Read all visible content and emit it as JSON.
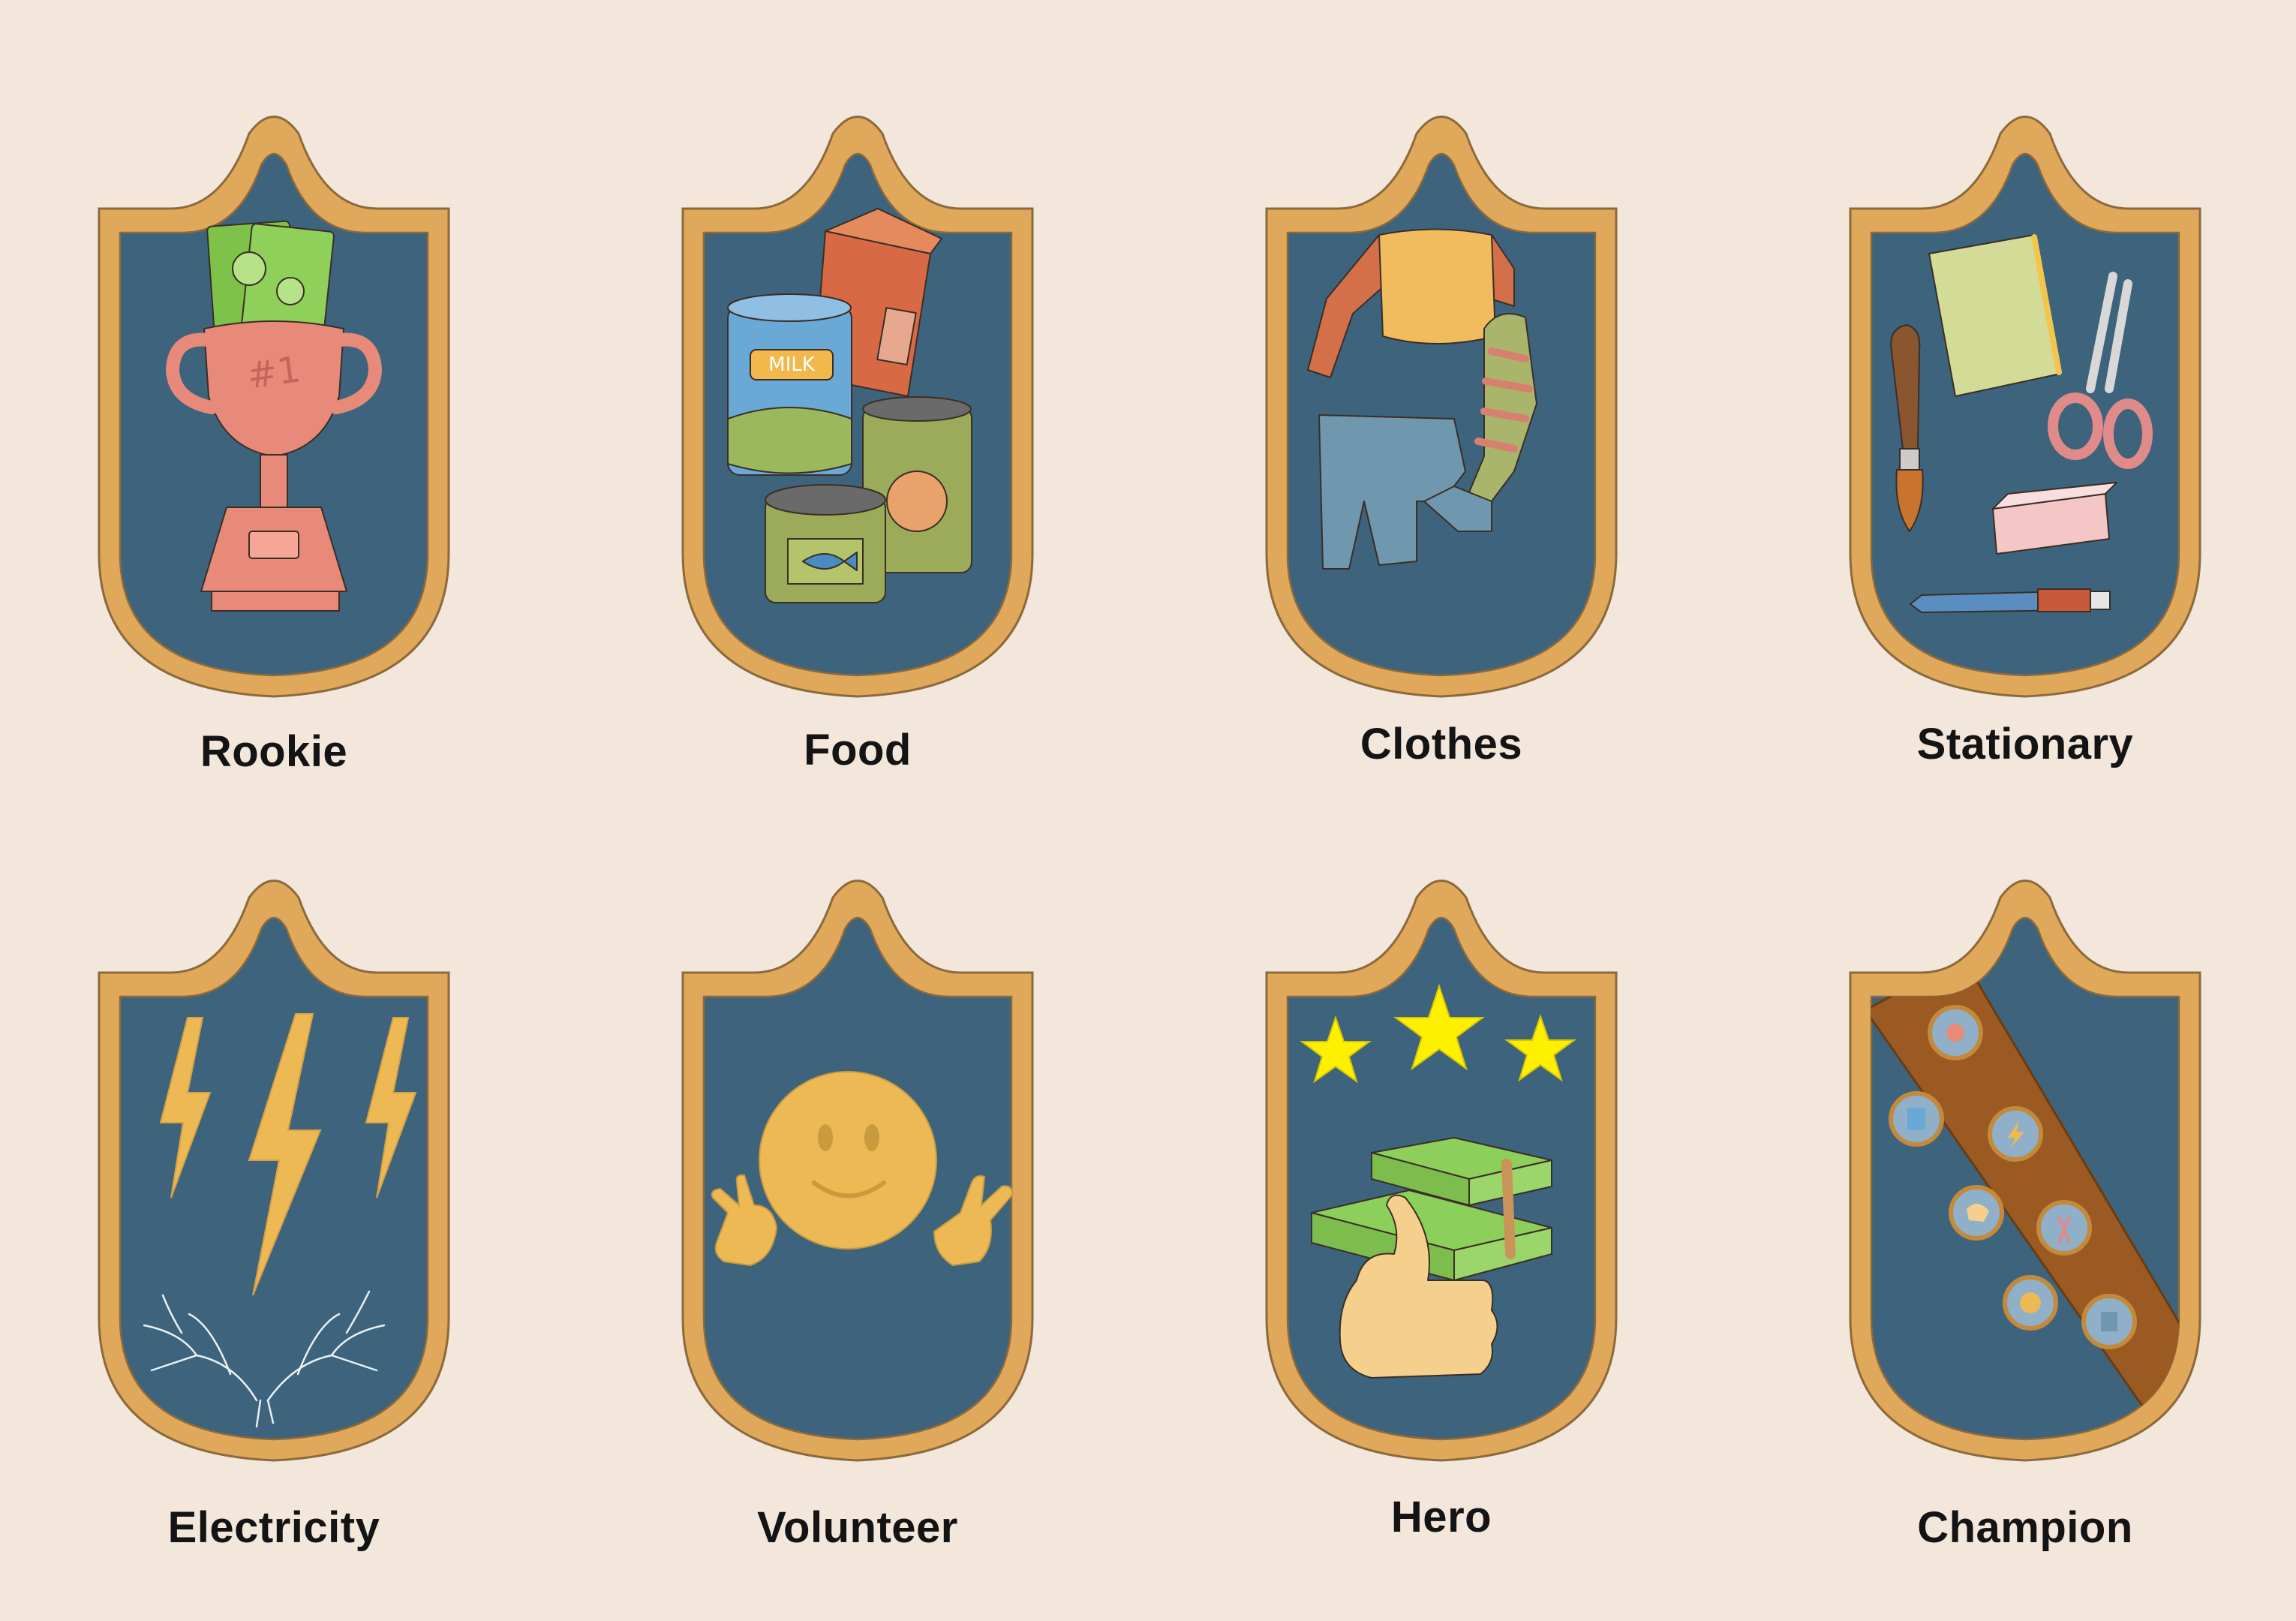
{
  "badges": [
    {
      "label": "Rookie",
      "icon": "trophy-with-cash-icon"
    },
    {
      "label": "Food",
      "icon": "food-cans-icon"
    },
    {
      "label": "Clothes",
      "icon": "clothes-icon"
    },
    {
      "label": "Stationary",
      "icon": "stationery-icon"
    },
    {
      "label": "Electricity",
      "icon": "lightning-bolts-icon"
    },
    {
      "label": "Volunteer",
      "icon": "smiley-peace-icon"
    },
    {
      "label": "Hero",
      "icon": "stars-cash-thumbs-up-icon"
    },
    {
      "label": "Champion",
      "icon": "badge-sash-icon"
    }
  ],
  "artwork_text": {
    "trophy_number": "#1",
    "milk_can_label": "MILK"
  },
  "colors": {
    "background": "#f3e6db",
    "shield_border": "#e0a85a",
    "shield_fill": "#3d647c",
    "label_text": "#141414"
  }
}
